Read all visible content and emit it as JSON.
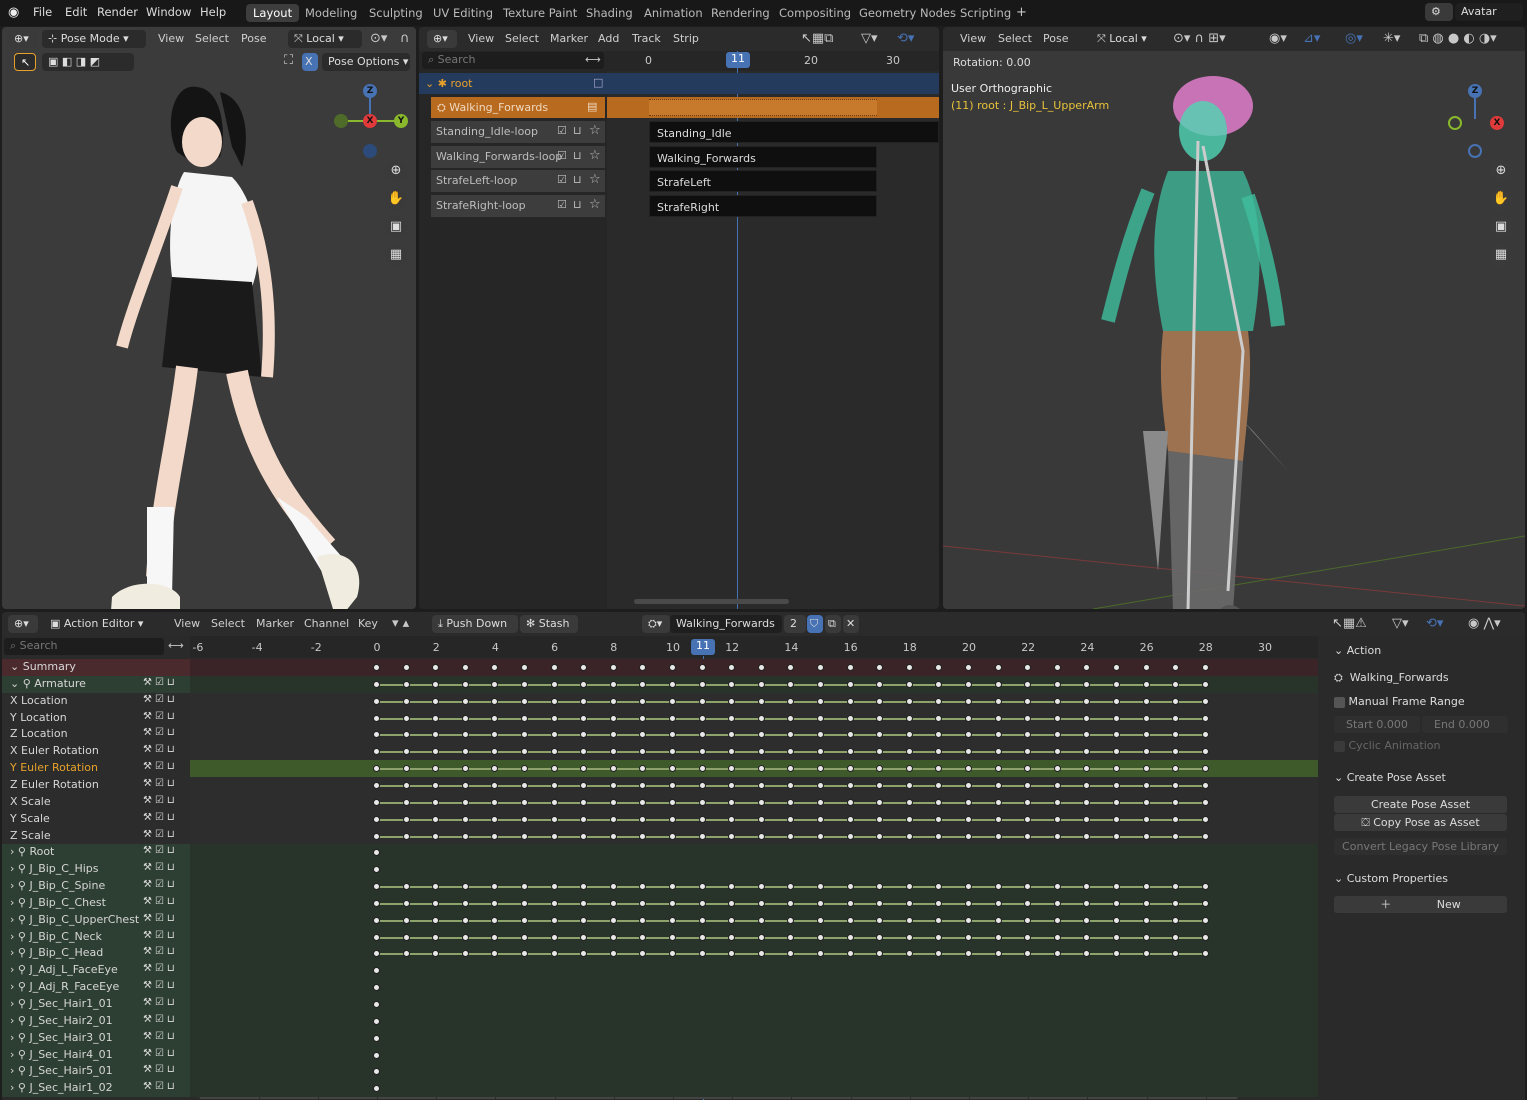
{
  "app": {
    "logo": "blender-icon",
    "menus": [
      "File",
      "Edit",
      "Render",
      "Window",
      "Help"
    ]
  },
  "workspaces": [
    {
      "label": "Layout",
      "active": true
    },
    {
      "label": "Modeling"
    },
    {
      "label": "Sculpting"
    },
    {
      "label": "UV Editing"
    },
    {
      "label": "Texture Paint"
    },
    {
      "label": "Shading"
    },
    {
      "label": "Animation"
    },
    {
      "label": "Rendering"
    },
    {
      "label": "Compositing"
    },
    {
      "label": "Geometry Nodes"
    },
    {
      "label": "Scripting"
    }
  ],
  "scene": {
    "name": "Avatar"
  },
  "viewport_left": {
    "mode": "Pose Mode",
    "menus": [
      "View",
      "Select",
      "Pose"
    ],
    "transform": "Local",
    "pose_options": "Pose Options",
    "x_toggle": "X"
  },
  "nla": {
    "menus": [
      "View",
      "Select",
      "Marker",
      "Add",
      "Track",
      "Strip"
    ],
    "search_placeholder": "Search",
    "ruler": [
      "0",
      "11",
      "20",
      "30"
    ],
    "current_frame": "11",
    "root": "root",
    "active_action": "Walking_Forwards",
    "tracks": [
      {
        "name": "Standing_Idle-loop",
        "strip": "Standing_Idle"
      },
      {
        "name": "Walking_Forwards-loop",
        "strip": "Walking_Forwards"
      },
      {
        "name": "StrafeLeft-loop",
        "strip": "StrafeLeft"
      },
      {
        "name": "StrafeRight-loop",
        "strip": "StrafeRight"
      }
    ]
  },
  "viewport_right": {
    "menus": [
      "View",
      "Select",
      "Pose"
    ],
    "transform": "Local",
    "rotation": "Rotation: 0.00",
    "view_name": "User Orthographic",
    "active_bone": "(11) root : J_Bip_L_UpperArm"
  },
  "action_editor": {
    "editor": "Action Editor",
    "menus": [
      "View",
      "Select",
      "Marker",
      "Channel",
      "Key"
    ],
    "push_down": "Push Down",
    "stash": "Stash",
    "action": "Walking_Forwards",
    "users": "2",
    "search_placeholder": "Search",
    "ruler": [
      "-6",
      "-4",
      "-2",
      "0",
      "2",
      "4",
      "6",
      "8",
      "10",
      "11",
      "12",
      "14",
      "16",
      "18",
      "20",
      "22",
      "24",
      "26",
      "28",
      "30"
    ],
    "current_frame": "11",
    "channels": [
      {
        "label": "Summary",
        "type": "summary"
      },
      {
        "label": "Armature",
        "type": "object"
      },
      {
        "label": "X Location",
        "type": "fcurve"
      },
      {
        "label": "Y Location",
        "type": "fcurve"
      },
      {
        "label": "Z Location",
        "type": "fcurve"
      },
      {
        "label": "X Euler Rotation",
        "type": "fcurve"
      },
      {
        "label": "Y Euler Rotation",
        "type": "fcurve",
        "selected": true
      },
      {
        "label": "Z Euler Rotation",
        "type": "fcurve"
      },
      {
        "label": "X Scale",
        "type": "fcurve"
      },
      {
        "label": "Y Scale",
        "type": "fcurve"
      },
      {
        "label": "Z Scale",
        "type": "fcurve"
      },
      {
        "label": "Root",
        "type": "group",
        "single": true
      },
      {
        "label": "J_Bip_C_Hips",
        "type": "group",
        "single": true
      },
      {
        "label": "J_Bip_C_Spine",
        "type": "group"
      },
      {
        "label": "J_Bip_C_Chest",
        "type": "group"
      },
      {
        "label": "J_Bip_C_UpperChest",
        "type": "group"
      },
      {
        "label": "J_Bip_C_Neck",
        "type": "group"
      },
      {
        "label": "J_Bip_C_Head",
        "type": "group"
      },
      {
        "label": "J_Adj_L_FaceEye",
        "type": "group",
        "single": true
      },
      {
        "label": "J_Adj_R_FaceEye",
        "type": "group",
        "single": true
      },
      {
        "label": "J_Sec_Hair1_01",
        "type": "group",
        "single": true
      },
      {
        "label": "J_Sec_Hair2_01",
        "type": "group",
        "single": true
      },
      {
        "label": "J_Sec_Hair3_01",
        "type": "group",
        "single": true
      },
      {
        "label": "J_Sec_Hair4_01",
        "type": "group",
        "single": true
      },
      {
        "label": "J_Sec_Hair5_01",
        "type": "group",
        "single": true
      },
      {
        "label": "J_Sec_Hair1_02",
        "type": "group",
        "single": true
      }
    ]
  },
  "sidebar": {
    "action_header": "Action",
    "action_name": "Walking_Forwards",
    "manual_frame_range": "Manual Frame Range",
    "start_label": "Start",
    "start_value": "0.000",
    "end_label": "End",
    "end_value": "0.000",
    "cyclic": "Cyclic Animation",
    "pose_header": "Create Pose Asset",
    "create_pose": "Create Pose Asset",
    "copy_pose": "Copy Pose as Asset",
    "convert": "Convert Legacy Pose Library",
    "custom_header": "Custom Properties",
    "new": "New"
  },
  "colors": {
    "accent": "#4772b3",
    "strip_orange": "#b86a1e",
    "fcurve_green": "#8ea36b",
    "selected_text": "#e8a22a"
  }
}
